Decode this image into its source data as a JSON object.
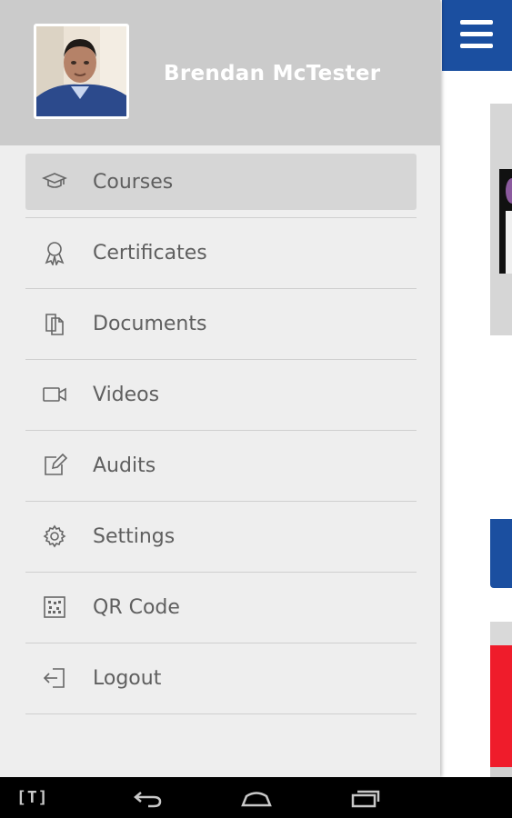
{
  "user": {
    "name": "Brendan McTester"
  },
  "menu": [
    {
      "label": "Courses",
      "icon": "graduation-cap-icon",
      "active": true
    },
    {
      "label": "Certificates",
      "icon": "award-ribbon-icon"
    },
    {
      "label": "Documents",
      "icon": "documents-icon"
    },
    {
      "label": "Videos",
      "icon": "video-camera-icon"
    },
    {
      "label": "Audits",
      "icon": "edit-icon"
    },
    {
      "label": "Settings",
      "icon": "gear-icon"
    },
    {
      "label": "QR Code",
      "icon": "qr-code-icon"
    },
    {
      "label": "Logout",
      "icon": "logout-icon"
    }
  ],
  "statusbar": {
    "tray_label": "[T]"
  },
  "colors": {
    "brand_blue": "#1b4fa0",
    "drawer_bg": "#eeeeee",
    "drawer_header": "#cbcbcb",
    "active_item": "#d6d6d6",
    "accent_red": "#ef1c2b"
  }
}
